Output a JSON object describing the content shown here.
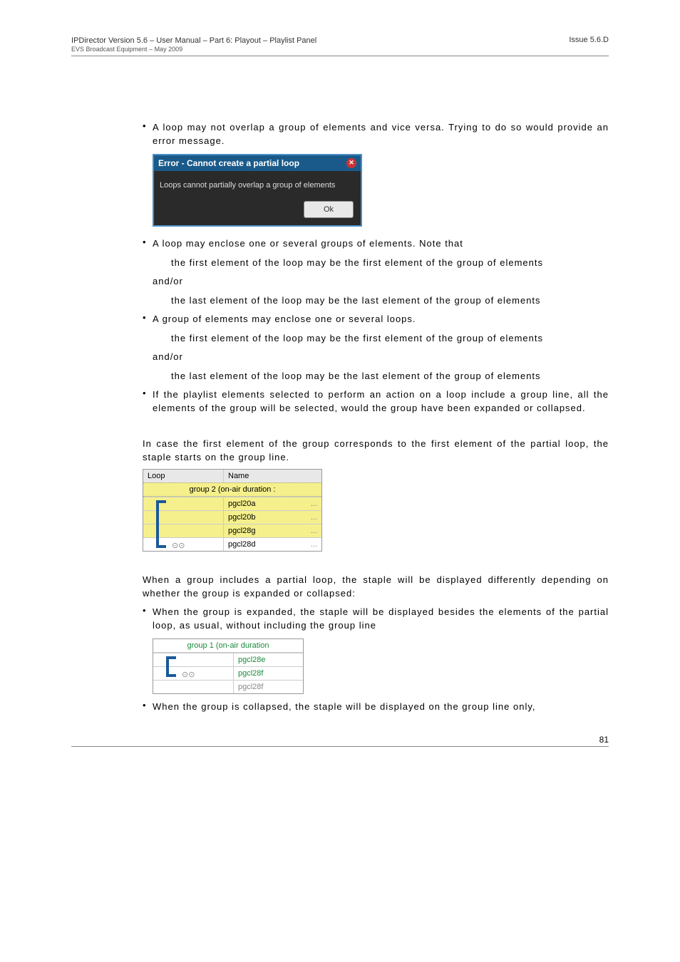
{
  "header": {
    "title": "IPDirector Version 5.6 – User Manual – Part 6: Playout – Playlist Panel",
    "sub": "EVS Broadcast Equipment – May 2009",
    "issue": "Issue 5.6.D"
  },
  "bullets": {
    "b1": "A loop may not overlap a group of elements and vice versa. Trying to do so would provide an error message.",
    "b2": "A loop may enclose one or several groups of elements. Note that",
    "b2_sub1": "the first element of the loop may be the first element of the group of elements",
    "b2_andor": "and/or",
    "b2_sub2": "the last element of the loop may be the last element of the group of elements",
    "b3": "A group of elements may enclose one or several loops.",
    "b3_sub1": "the first element of the loop may be the first element of the group of elements",
    "b3_andor": "and/or",
    "b3_sub2": "the last element of the loop may be the last element of the group of elements",
    "b4": "If the playlist elements selected to perform an action on a loop include a group line, all the elements of the group will be selected, would the group have been expanded or collapsed.",
    "b5": "When the group is expanded, the staple will be displayed besides the elements of the partial loop, as usual, without including the group line",
    "b6": "When the group is collapsed, the staple will be displayed on the group line only,"
  },
  "paras": {
    "p1": "In case the first element of the group corresponds to the first element of the partial loop, the staple starts on the group line.",
    "p2": "When a group includes a partial loop, the staple will be displayed differently depending on whether the group is expanded or collapsed:"
  },
  "error_dialog": {
    "title": "Error - Cannot create a partial loop",
    "body": "Loops cannot partially overlap a group of elements",
    "ok": "Ok"
  },
  "table1": {
    "col_loop": "Loop",
    "col_name": "Name",
    "group": "group 2  (on-air duration :",
    "rows": [
      {
        "name": "pgcl20a",
        "yellow": true
      },
      {
        "name": "pgcl20b",
        "yellow": true
      },
      {
        "name": "pgcl28g",
        "yellow": true
      },
      {
        "name": "pgcl28d",
        "yellow": false
      }
    ]
  },
  "table2": {
    "group": "group 1  (on-air duration",
    "rows": [
      {
        "name": "pgcl28e"
      },
      {
        "name": "pgcl28f"
      },
      {
        "name": "pgcl28f"
      }
    ]
  },
  "page_num": "81"
}
